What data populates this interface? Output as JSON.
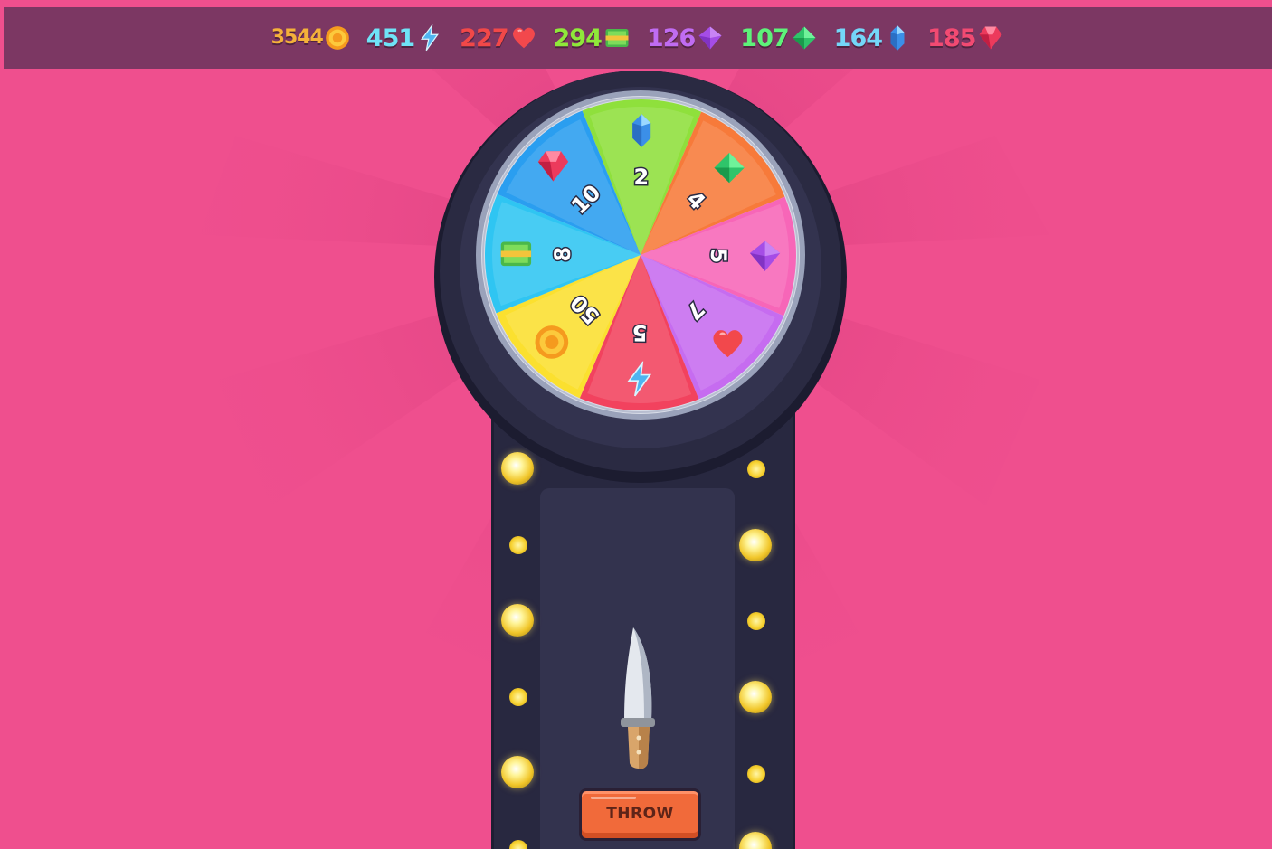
{
  "resources": [
    {
      "id": "coins",
      "value": "3544",
      "color": "#f5b13a",
      "icon": "coin-icon"
    },
    {
      "id": "energy",
      "value": "451",
      "color": "#6fe3f7",
      "icon": "lightning-icon"
    },
    {
      "id": "hearts",
      "value": "227",
      "color": "#f24848",
      "icon": "heart-icon"
    },
    {
      "id": "cash",
      "value": "294",
      "color": "#8fe83a",
      "icon": "cash-icon"
    },
    {
      "id": "purple_gems",
      "value": "126",
      "color": "#c06cf2",
      "icon": "purple-gem-icon"
    },
    {
      "id": "green_gems",
      "value": "107",
      "color": "#5ef27a",
      "icon": "green-gem-icon"
    },
    {
      "id": "blue_crystals",
      "value": "164",
      "color": "#74d6f8",
      "icon": "blue-crystal-icon"
    },
    {
      "id": "rubies",
      "value": "185",
      "color": "#f24a72",
      "icon": "ruby-icon"
    }
  ],
  "wheel": {
    "segments": [
      {
        "label": "2",
        "reward": "blue-crystal",
        "color": "#8fe03c"
      },
      {
        "label": "4",
        "reward": "green-gem",
        "color": "#f77a3a"
      },
      {
        "label": "5",
        "reward": "purple-gem",
        "color": "#f766b8"
      },
      {
        "label": "7",
        "reward": "heart",
        "color": "#c66cf0"
      },
      {
        "label": "5",
        "reward": "lightning",
        "color": "#f2425e"
      },
      {
        "label": "50",
        "reward": "coin",
        "color": "#fbe02f"
      },
      {
        "label": "8",
        "reward": "cash",
        "color": "#2fc5f2"
      },
      {
        "label": "10",
        "reward": "ruby",
        "color": "#2a9ef0"
      }
    ]
  },
  "controls": {
    "throw_label": "THROW"
  }
}
